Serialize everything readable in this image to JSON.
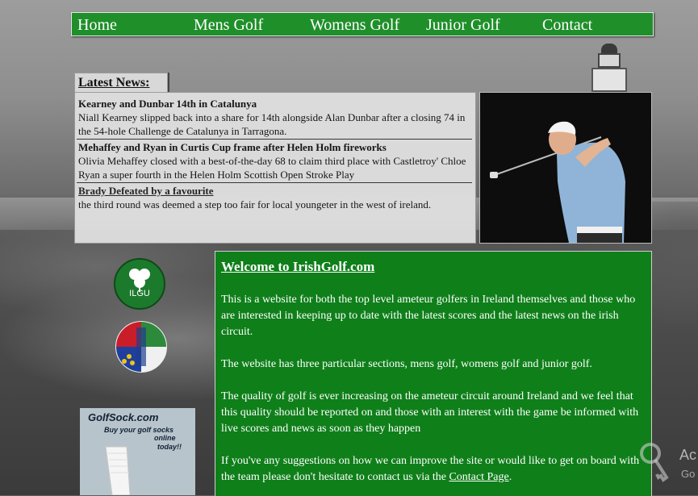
{
  "nav": {
    "items": [
      {
        "label": "Home"
      },
      {
        "label": "Mens Golf"
      },
      {
        "label": "Womens Golf"
      },
      {
        "label": "Junior Golf"
      },
      {
        "label": "Contact"
      }
    ]
  },
  "news": {
    "tab_label": "Latest News:",
    "items": [
      {
        "headline": "Kearney and Dunbar 14th in Catalunya",
        "body": "Niall Kearney slipped back into a share for 14th alongside Alan Dunbar after a closing 74 in the 54-hole Challenge de Catalunya in Tarragona."
      },
      {
        "headline": "Mehaffey and Ryan in Curtis Cup frame after Helen Holm fireworks",
        "body": "Olivia Mehaffey closed with a best-of-the-day 68 to claim third place with Castletroy' Chloe Ryan a super fourth in the Helen Holm Scottish Open Stroke Play"
      },
      {
        "headline": "Brady Defeated by a favourite",
        "body": "the third round was deemed a step too fair for local youngeter in the west of ireland."
      }
    ]
  },
  "logos": {
    "ilgu_text": "ILGU"
  },
  "ad": {
    "title": "GolfSock.com",
    "line1": "Buy your golf socks",
    "line2": "online",
    "line3": "today!!"
  },
  "welcome": {
    "title": "Welcome to IrishGolf.com",
    "p1": "This is a website for both the top level ameteur golfers in Ireland themselves and those who are interested in keeping up to date with the latest scores and the latest news on the irish circuit.",
    "p2": "The website has three particular sections, mens golf, womens golf and junior golf.",
    "p3": "The quality of golf is ever increasing on the ameteur circuit around Ireland and we feel that this quality should be reported on and those with an interest with the game be informed with live scores and news as soon as they happen",
    "p4_prefix": "If you've any suggestions on how we can improve the site or would like to get on board with the team please don't hesitate to contact us via the ",
    "p4_link": "Contact Page",
    "p4_suffix": "."
  },
  "watermark": {
    "line1": "Ac",
    "line2": "Go"
  },
  "colors": {
    "nav_green": "#1f8f2a",
    "panel_green": "#0f7f1a",
    "news_bg": "#e0e0e0"
  }
}
